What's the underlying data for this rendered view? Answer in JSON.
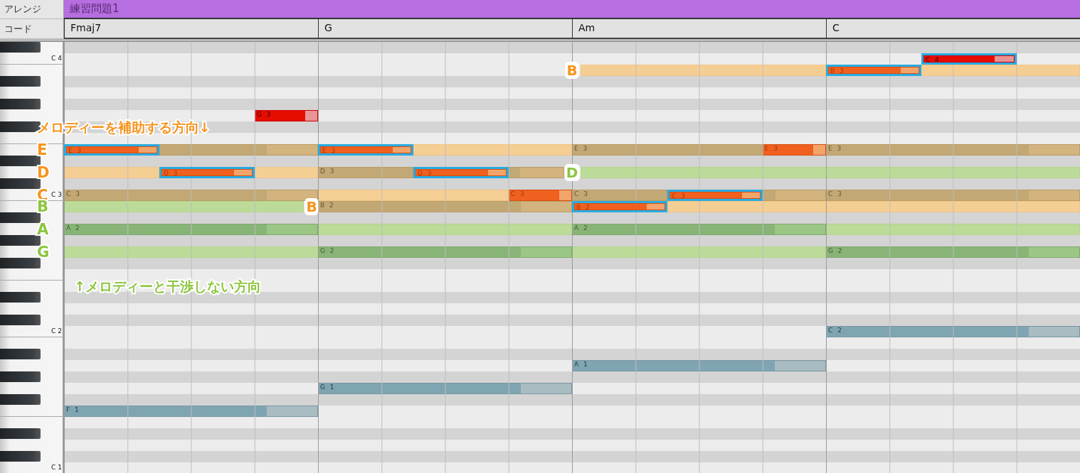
{
  "track": {
    "header": "アレンジ",
    "name": "練習問題1"
  },
  "chord_track": {
    "header": "コード",
    "chords": [
      "Fmaj7",
      "G",
      "Am",
      "C"
    ]
  },
  "rows": [
    {
      "black": true
    },
    {
      "black": false,
      "key_label": "C 4",
      "notes": [
        {
          "label": "C 4",
          "kind": "lead",
          "level": 0.79,
          "highlighted": true
        }
      ]
    },
    {
      "black": false,
      "notes": [
        {
          "kind": "tension"
        },
        {
          "kind": "tension"
        },
        {
          "label": "B 3",
          "kind": "melody",
          "level": 0.8,
          "highlighted": true
        }
      ],
      "markers": [
        {
          "kind": "grid",
          "text": "B",
          "color": "#f7941d"
        }
      ]
    },
    {
      "black": true
    },
    {
      "black": false
    },
    {
      "black": true
    },
    {
      "black": false,
      "notes": [
        {
          "label": "G 3",
          "kind": "lead",
          "level": 0.8,
          "highlighted": false
        }
      ]
    },
    {
      "black": true,
      "markers": [
        {
          "kind": "phrase",
          "text": "メロディーを補助する方向↓",
          "color": "#f7941d"
        }
      ]
    },
    {
      "black": false
    },
    {
      "black": false,
      "notes": [
        {
          "kind": "chord",
          "level": 0.68
        },
        {
          "label": "E 3",
          "kind": "melody",
          "level": 0.8,
          "highlighted": true
        },
        {
          "kind": "tension"
        },
        {
          "label": "E 3",
          "kind": "melody",
          "level": 0.8,
          "highlighted": true
        },
        {
          "label": "E 3",
          "kind": "chord"
        },
        {
          "label": "E 3",
          "kind": "melody",
          "level": 0.8,
          "highlighted": false
        },
        {
          "label": "E 3",
          "kind": "chord",
          "level": 0.8
        }
      ],
      "markers": [
        {
          "kind": "side",
          "text": "E",
          "color": "#f7941d"
        }
      ]
    },
    {
      "black": true
    },
    {
      "black": false,
      "notes": [
        {
          "kind": "tension"
        },
        {
          "kind": "tension"
        },
        {
          "label": "D 3",
          "kind": "melody",
          "level": 0.8,
          "highlighted": true
        },
        {
          "label": "D 3",
          "kind": "chord"
        },
        {
          "kind": "chord",
          "level": 0.2
        },
        {
          "label": "D 3",
          "kind": "melody",
          "level": 0.8,
          "highlighted": true
        },
        {
          "kind": "pale"
        }
      ],
      "markers": [
        {
          "kind": "side",
          "text": "D",
          "color": "#f7941d"
        },
        {
          "kind": "grid",
          "text": "D",
          "color": "#8cc63f"
        }
      ]
    },
    {
      "black": true
    },
    {
      "black": false,
      "key_label": "C 3",
      "notes": [
        {
          "label": "C 3",
          "kind": "chord",
          "level": 0.8
        },
        {
          "kind": "tension"
        },
        {
          "label": "C 3",
          "kind": "melody",
          "level": 0.8,
          "highlighted": false
        },
        {
          "label": "C 3",
          "kind": "chord"
        },
        {
          "kind": "chord",
          "level": 0.2
        },
        {
          "label": "C 3",
          "kind": "melody",
          "level": 0.8,
          "highlighted": true
        },
        {
          "label": "C 3",
          "kind": "chord",
          "level": 0.8
        }
      ],
      "markers": [
        {
          "kind": "side",
          "text": "C",
          "color": "#f7941d"
        }
      ]
    },
    {
      "black": false,
      "notes": [
        {
          "kind": "pale"
        },
        {
          "label": "B 2",
          "kind": "chord",
          "level": 0.8
        },
        {
          "kind": "tension"
        },
        {
          "label": "B 2",
          "kind": "melody",
          "level": 0.8,
          "highlighted": true
        }
      ],
      "markers": [
        {
          "kind": "side",
          "text": "B",
          "color": "#8cc63f"
        },
        {
          "kind": "grid",
          "text": "B",
          "color": "#f7941d"
        }
      ]
    },
    {
      "black": true
    },
    {
      "black": false,
      "notes": [
        {
          "label": "A 2",
          "kind": "guide",
          "level": 0.8
        },
        {
          "kind": "pale"
        },
        {
          "label": "A 2",
          "kind": "guide",
          "level": 0.8
        },
        {
          "kind": "pale"
        }
      ],
      "markers": [
        {
          "kind": "side",
          "text": "A",
          "color": "#8cc63f"
        }
      ]
    },
    {
      "black": true
    },
    {
      "black": false,
      "notes": [
        {
          "kind": "pale"
        },
        {
          "label": "G 2",
          "kind": "guide",
          "level": 0.8
        },
        {
          "kind": "pale"
        },
        {
          "label": "G 2",
          "kind": "guide",
          "level": 0.8
        }
      ],
      "markers": [
        {
          "kind": "side",
          "text": "G",
          "color": "#8cc63f"
        }
      ]
    },
    {
      "black": true
    },
    {
      "black": false
    },
    {
      "black": false,
      "markers": [
        {
          "kind": "phrase",
          "text": "↑メロディーと干渉しない方向",
          "color": "#8cc63f"
        }
      ]
    },
    {
      "black": true
    },
    {
      "black": false
    },
    {
      "black": true
    },
    {
      "black": false,
      "key_label": "C 2",
      "notes": [
        {
          "label": "C 2",
          "kind": "bass",
          "level": 0.8
        }
      ]
    },
    {
      "black": false
    },
    {
      "black": true
    },
    {
      "black": false,
      "notes": [
        {
          "label": "A 1",
          "kind": "bass",
          "level": 0.8
        }
      ]
    },
    {
      "black": true
    },
    {
      "black": false,
      "notes": [
        {
          "label": "G 1",
          "kind": "bass",
          "level": 0.8
        }
      ]
    },
    {
      "black": true
    },
    {
      "black": false,
      "notes": [
        {
          "label": "F 1",
          "kind": "bass",
          "level": 0.8
        }
      ]
    },
    {
      "black": false
    },
    {
      "black": true
    },
    {
      "black": false
    },
    {
      "black": true
    },
    {
      "black": false,
      "key_label": "C 1"
    }
  ]
}
